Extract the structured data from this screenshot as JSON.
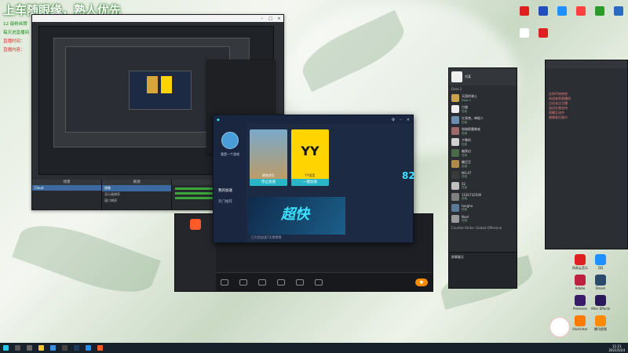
{
  "overlay": {
    "title": "上车随眼缘，熟人优先",
    "line1": "12 级粉丝牌",
    "line2": "每天进直播间",
    "line3": "直播时间：",
    "line4": "直播内容："
  },
  "obs": {
    "dock_scenes": "场景",
    "dock_sources": "来源",
    "dock_mixer": "混音器",
    "scene_item": "Cloud",
    "source_items": [
      "图像",
      "显示器捕获",
      "窗口捕获"
    ]
  },
  "accel": {
    "user_name": "我是一个游戏",
    "menu_speed": "我的加速",
    "menu_rec": "热门推荐",
    "game1": "绝地求生",
    "game1_btn": "停止加速",
    "game2": "YY语音",
    "game2_btn": "一键加速",
    "yy_logo": "YY",
    "banner_text": "超快",
    "speed": "82",
    "footer": "已为您加速7天零零零"
  },
  "chat": {
    "header_name": "刘某",
    "header_sub": "Dota 2",
    "section2": "Counter-Strike: Global Offensive",
    "items": [
      {
        "name": "天国的骑士",
        "sub": "Dota 2"
      },
      {
        "name": "白猫",
        "sub": "在线"
      },
      {
        "name": "红泉夜，神棍人",
        "sub": "在线"
      },
      {
        "name": "和暗群魔尊者",
        "sub": "在线"
      },
      {
        "name": "夕晚的",
        "sub": "在线"
      },
      {
        "name": "幽冥幻",
        "sub": "在线"
      },
      {
        "name": "糖豆豆",
        "sub": "在线"
      },
      {
        "name": "NO.47",
        "sub": "在线"
      },
      {
        "name": "02",
        "sub": "在线"
      },
      {
        "name": "1181732500",
        "sub": "在线"
      },
      {
        "name": "tongha",
        "sub": "在线"
      },
      {
        "name": "Noel",
        "sub": "在线"
      }
    ],
    "footer": "群聊聊天"
  },
  "right_panel": {
    "lines": [
      "比特币哈哈哈",
      "欢迎来到直播间",
      "点击关注主播",
      "送出礼物支持",
      "直播互动中",
      "感谢各位观众"
    ]
  },
  "desktop_icons": [
    {
      "label": "网易云音乐",
      "color": "#e02020"
    },
    {
      "label": "QQ",
      "color": "#1e90ff"
    },
    {
      "label": "Adobe",
      "color": "#c02040"
    },
    {
      "label": "Steam",
      "color": "#2a4a6a"
    },
    {
      "label": "Premiere",
      "color": "#3a1a6a"
    },
    {
      "label": "After Effects",
      "color": "#2a1a5a"
    },
    {
      "label": "Illustrator",
      "color": "#ff7a00"
    },
    {
      "label": "腾讯视频",
      "color": "#ff8a00"
    }
  ],
  "taskbar": {
    "time": "11:21",
    "date": "2021/5/24"
  }
}
